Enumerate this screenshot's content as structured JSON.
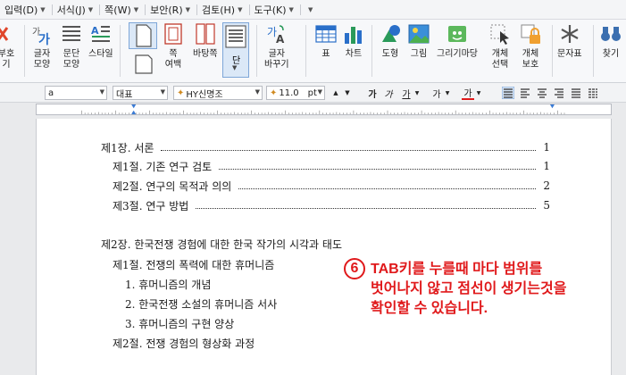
{
  "menu": [
    {
      "label": "입력(D)"
    },
    {
      "label": "서식(J)"
    },
    {
      "label": "쪽(W)"
    },
    {
      "label": "보안(R)"
    },
    {
      "label": "검토(H)"
    },
    {
      "label": "도구(K)"
    }
  ],
  "ribbon": {
    "partial_left": {
      "line1": "부호",
      "line2": "기"
    },
    "char_shape": {
      "line1": "글자",
      "line2": "모양"
    },
    "para_shape": {
      "line1": "문단",
      "line2": "모양"
    },
    "style": {
      "line1": "스타일"
    },
    "page_border": {
      "line1": "쪽",
      "line2": "여백"
    },
    "background": {
      "line1": "바탕쪽"
    },
    "column": {
      "line1": "단"
    },
    "char_change": {
      "line1": "글자",
      "line2": "바꾸기"
    },
    "table": {
      "line1": "표"
    },
    "chart": {
      "line1": "차트"
    },
    "shape": {
      "line1": "도형"
    },
    "picture": {
      "line1": "그림"
    },
    "draw_shape": {
      "line1": "그리기마당"
    },
    "object_select": {
      "line1": "개체",
      "line2": "선택"
    },
    "object_protect": {
      "line1": "개체",
      "line2": "보호"
    },
    "char_table": {
      "line1": "문자표"
    },
    "find": {
      "line1": "찾기"
    }
  },
  "format": {
    "style_value": "a",
    "lang_value": "대표",
    "font_value": "HY신명조",
    "size_value": "11.0",
    "unit_value": "pt",
    "bold": "가",
    "italic": "가",
    "underline": "가",
    "strike": "가",
    "color": "가"
  },
  "document": {
    "toc": [
      {
        "text": "제1장. 서론",
        "page": "1"
      },
      {
        "text": "제1절. 기존 연구 검토",
        "page": "1"
      },
      {
        "text": "제2절. 연구의 목적과 의의",
        "page": "2"
      },
      {
        "text": "제3절. 연구 방법",
        "page": "5"
      }
    ],
    "chapter2": "제2장. 한국전쟁 경험에 대한 한국 작가의 시각과 태도",
    "section1": "제1절. 전쟁의 폭력에 대한 휴머니즘",
    "items": [
      "1. 휴머니즘의 개념",
      "2. 한국전쟁 소설의 휴머니즘 서사",
      "3. 휴머니즘의 구현 양상"
    ],
    "section2": "제2절. 전쟁 경험의 형상화 과정"
  },
  "callout": {
    "number": "6",
    "lines": [
      "TAB키를 누를때 마다 범위를",
      "벗어나지 않고 점선이 생기는것을",
      "확인할 수 있습니다."
    ],
    "color": "#e0191b"
  }
}
